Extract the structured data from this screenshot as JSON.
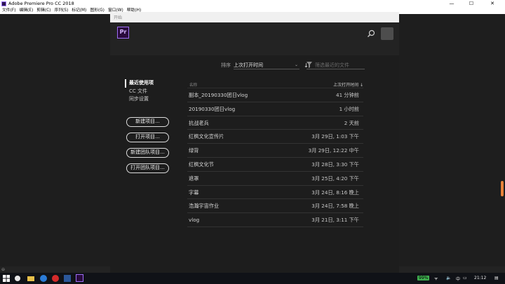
{
  "window": {
    "title": "Adobe Premiere Pro CC 2018",
    "minimize": "—",
    "maximize": "☐",
    "close": "✕"
  },
  "menu": [
    "文件(F)",
    "编辑(E)",
    "剪辑(C)",
    "序列(S)",
    "标记(M)",
    "图形(G)",
    "窗口(W)",
    "帮助(H)"
  ],
  "dialog": {
    "title": "开始",
    "logo": "Pr",
    "sort_label": "排序",
    "sort_value": "上次打开时间",
    "filter_placeholder": "筛选最近的文件"
  },
  "sidebar": {
    "items": [
      "最近使用项",
      "CC 文件",
      "同步设置"
    ],
    "buttons": [
      "新建项目...",
      "打开项目...",
      "新建团队项目...",
      "打开团队项目..."
    ]
  },
  "table": {
    "col_name": "名称",
    "col_time": "上次打开时间 ↓",
    "rows": [
      {
        "name": "副本_20190330团日vlog",
        "time": "41 分钟前"
      },
      {
        "name": "20190330团日vlog",
        "time": "1 小时前"
      },
      {
        "name": "抗战老兵",
        "time": "2 天前"
      },
      {
        "name": "红枫文化宣传片",
        "time": "3月 29日, 1:03 下午"
      },
      {
        "name": "绿背",
        "time": "3月 29日, 12:22 中午"
      },
      {
        "name": "红枫文化节",
        "time": "3月 28日, 3:30 下午"
      },
      {
        "name": "遮罩",
        "time": "3月 25日, 4:20 下午"
      },
      {
        "name": "字幕",
        "time": "3月 24日, 8:16 晚上"
      },
      {
        "name": "浩瀚宇宙作业",
        "time": "3月 24日, 7:58 晚上"
      },
      {
        "name": "vlog",
        "time": "3月 21日, 3:11 下午"
      }
    ]
  },
  "taskbar": {
    "battery": "99%",
    "ime": "中",
    "clock": "21:12"
  },
  "colors": {
    "premiere_purple": "#9d6ef6",
    "background": "#1e1e1e"
  }
}
